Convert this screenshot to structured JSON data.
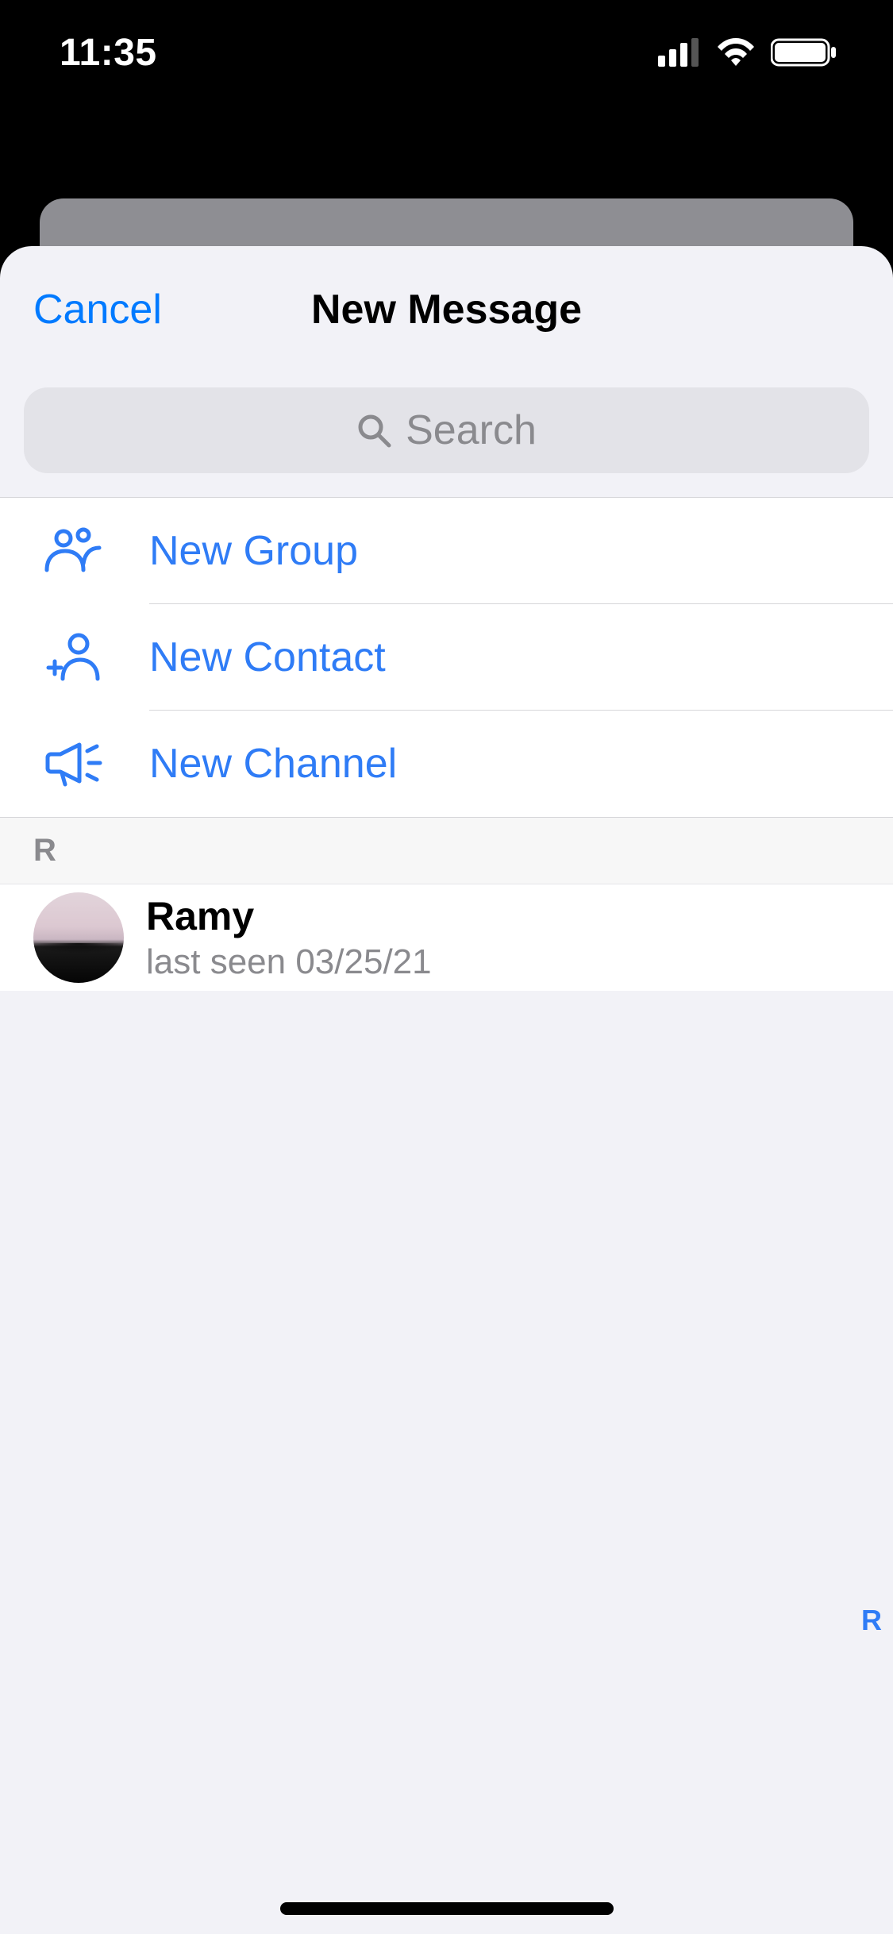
{
  "status_bar": {
    "time": "11:35"
  },
  "header": {
    "cancel_label": "Cancel",
    "title": "New Message"
  },
  "search": {
    "placeholder": "Search"
  },
  "actions": {
    "new_group": "New Group",
    "new_contact": "New Contact",
    "new_channel": "New Channel"
  },
  "sections": [
    {
      "letter": "R",
      "contacts": [
        {
          "name": "Ramy",
          "status": "last seen 03/25/21"
        }
      ]
    }
  ],
  "index_bar": {
    "letter": "R"
  }
}
